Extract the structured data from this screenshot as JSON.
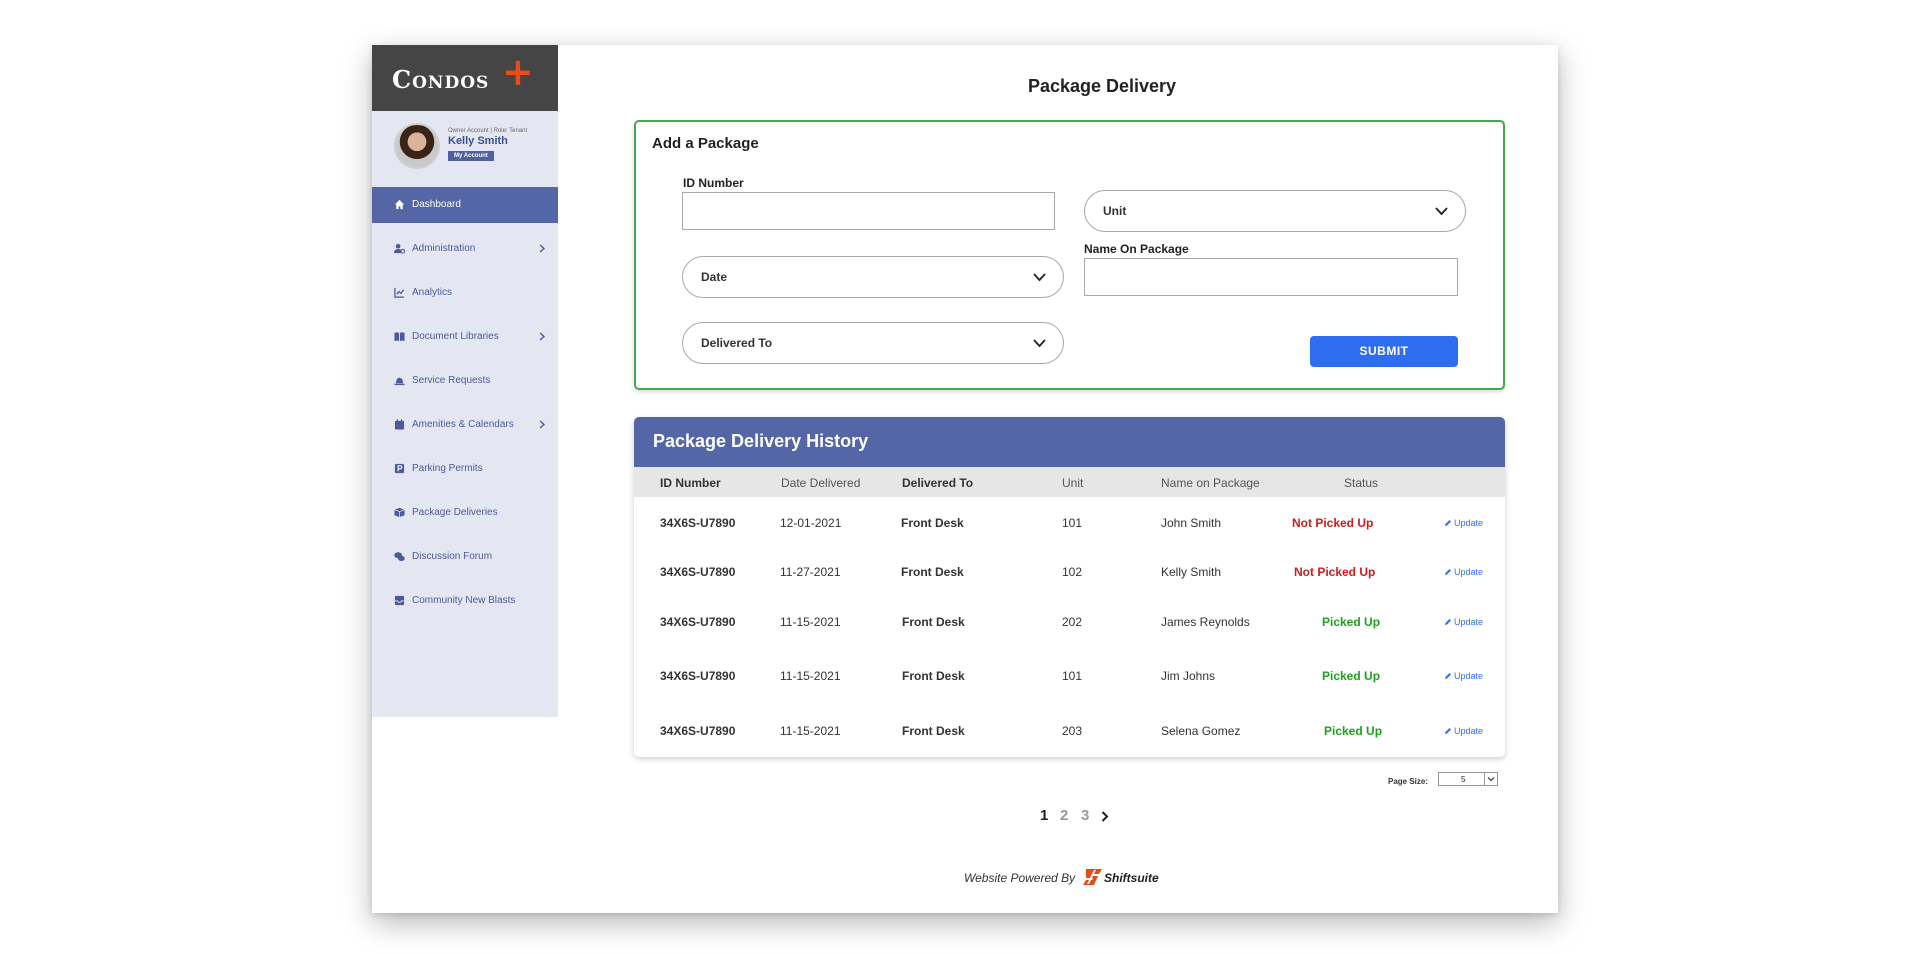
{
  "app": {
    "brand": "Condos",
    "brand_plus": "+",
    "colors": {
      "sidebar_bg": "#e4e7f1",
      "accent": "#5466a6",
      "logo_bar": "#454545",
      "plus": "#ea4b18",
      "submit": "#2f6df0"
    }
  },
  "user": {
    "role_text": "Owner Account | Role: Tenant",
    "name": "Kelly Smith",
    "account_button": "My Account"
  },
  "sidebar": {
    "items": [
      {
        "label": "Dashboard",
        "icon": "home-icon",
        "active": true,
        "has_submenu": false
      },
      {
        "label": "Administration",
        "icon": "user-gear-icon",
        "active": false,
        "has_submenu": true
      },
      {
        "label": "Analytics",
        "icon": "chart-icon",
        "active": false,
        "has_submenu": false
      },
      {
        "label": "Document Libraries",
        "icon": "book-icon",
        "active": false,
        "has_submenu": true
      },
      {
        "label": "Service Requests",
        "icon": "bell-icon",
        "active": false,
        "has_submenu": false
      },
      {
        "label": "Amenities & Calendars",
        "icon": "calendar-icon",
        "active": false,
        "has_submenu": true
      },
      {
        "label": "Parking Permits",
        "icon": "parking-icon",
        "active": false,
        "has_submenu": false
      },
      {
        "label": "Package Deliveries",
        "icon": "box-icon",
        "active": false,
        "has_submenu": false
      },
      {
        "label": "Discussion Forum",
        "icon": "comments-icon",
        "active": false,
        "has_submenu": false
      },
      {
        "label": "Community New Blasts",
        "icon": "inbox-icon",
        "active": false,
        "has_submenu": false
      }
    ]
  },
  "page": {
    "title": "Package Delivery"
  },
  "add_package": {
    "title": "Add a Package",
    "id_label": "ID Number",
    "id_value": "",
    "unit_select": "Unit",
    "date_select": "Date",
    "name_label": "Name On Package",
    "name_value": "",
    "delivered_to_select": "Delivered To",
    "submit": "SUBMIT"
  },
  "history": {
    "title": "Package Delivery History",
    "columns": [
      "ID Number",
      "Date Delivered",
      "Delivered To",
      "Unit",
      "Name on Package",
      "Status"
    ],
    "update_label": "Update",
    "rows": [
      {
        "id": "34X6S-U7890",
        "date": "12-01-2021",
        "delivered_to": "Front Desk",
        "unit": "101",
        "name": "John Smith",
        "status": "Not Picked Up",
        "picked": false
      },
      {
        "id": "34X6S-U7890",
        "date": "11-27-2021",
        "delivered_to": "Front Desk",
        "unit": "102",
        "name": "Kelly Smith",
        "status": "Not Picked Up",
        "picked": false
      },
      {
        "id": "34X6S-U7890",
        "date": "11-15-2021",
        "delivered_to": "Front Desk",
        "unit": "202",
        "name": "James Reynolds",
        "status": "Picked Up",
        "picked": true
      },
      {
        "id": "34X6S-U7890",
        "date": "11-15-2021",
        "delivered_to": "Front Desk",
        "unit": "101",
        "name": "Jim Johns",
        "status": "Picked Up",
        "picked": true
      },
      {
        "id": "34X6S-U7890",
        "date": "11-15-2021",
        "delivered_to": "Front Desk",
        "unit": "203",
        "name": "Selena Gomez",
        "status": "Picked Up",
        "picked": true
      }
    ]
  },
  "pagination": {
    "page_size_label": "Page Size:",
    "page_size": "5",
    "pages": [
      "1",
      "2",
      "3"
    ],
    "current": "1"
  },
  "footer": {
    "text": "Website Powered By",
    "brand": "Shiftsuite"
  }
}
